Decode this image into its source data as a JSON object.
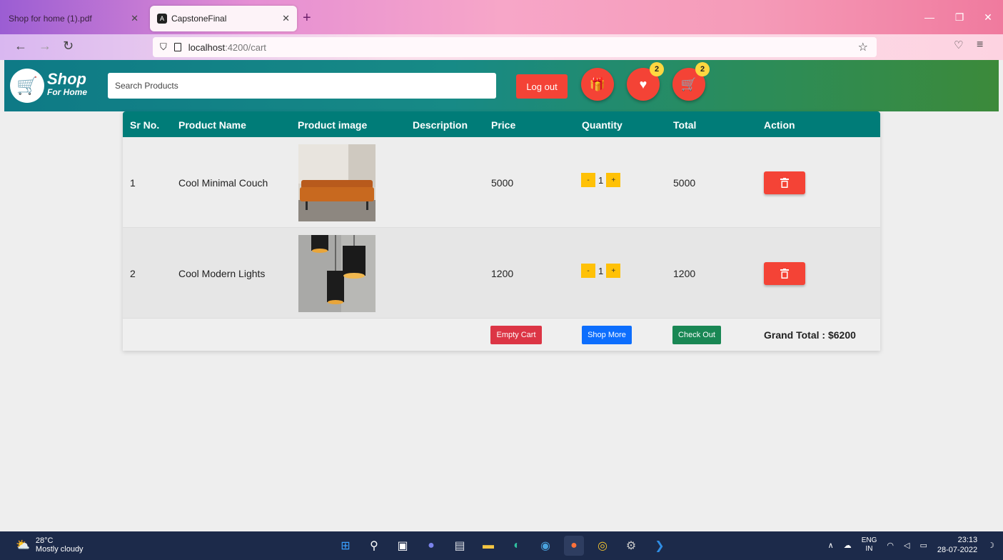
{
  "browser": {
    "tabs": [
      {
        "title": "Shop for home (1).pdf",
        "active": false
      },
      {
        "title": "CapstoneFinal",
        "active": true
      }
    ],
    "url_host": "localhost",
    "url_path": ":4200/cart"
  },
  "header": {
    "logo_line1": "Shop",
    "logo_line2": "For Home",
    "search_placeholder": "Search Products",
    "logout_label": "Log out",
    "wishlist_count": "2",
    "cart_count": "2"
  },
  "table": {
    "columns": [
      "Sr No.",
      "Product Name",
      "Product image",
      "Description",
      "Price",
      "Quantity",
      "Total",
      "Action"
    ],
    "rows": [
      {
        "sr": "1",
        "name": "Cool Minimal Couch",
        "description": "",
        "price": "5000",
        "qty": "1",
        "total": "5000"
      },
      {
        "sr": "2",
        "name": "Cool Modern Lights",
        "description": "",
        "price": "1200",
        "qty": "1",
        "total": "1200"
      }
    ],
    "qty_minus": "-",
    "qty_plus": "+",
    "empty_cart_label": "Empty Cart",
    "shop_more_label": "Shop More",
    "checkout_label": "Check Out",
    "grand_total": "Grand Total : $6200"
  },
  "taskbar": {
    "temperature": "28°C",
    "weather": "Mostly cloudy",
    "lang_top": "ENG",
    "lang_bottom": "IN",
    "time": "23:13",
    "date": "28-07-2022"
  },
  "colors": {
    "header_teal": "#007c78",
    "accent_red": "#f44336",
    "qty_yellow": "#ffc107",
    "empty_cart": "#dc3545",
    "shop_more": "#0d6efd",
    "checkout": "#198754"
  }
}
